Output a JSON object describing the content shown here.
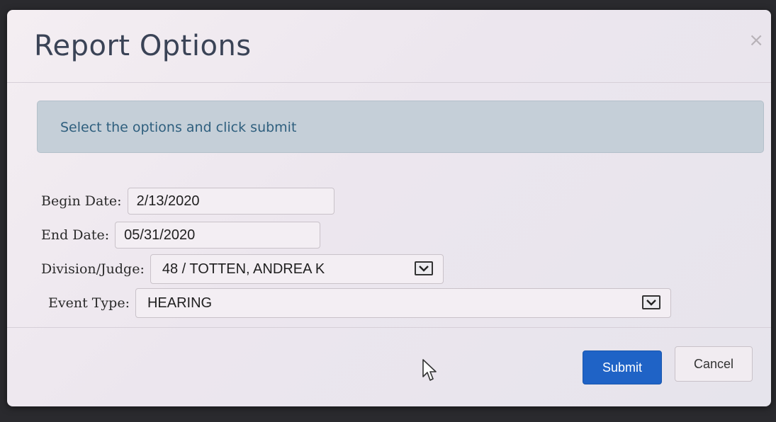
{
  "dialog": {
    "title": "Report Options",
    "close_label": "×"
  },
  "banner": {
    "text": "Select the options and click submit"
  },
  "form": {
    "begin_date": {
      "label": "Begin Date:",
      "value": "2/13/2020"
    },
    "end_date": {
      "label": "End Date:",
      "value": "05/31/2020"
    },
    "division_judge": {
      "label": "Division/Judge:",
      "value": "48 / TOTTEN, ANDREA K"
    },
    "event_type": {
      "label": "Event Type:",
      "value": "HEARING"
    }
  },
  "footer": {
    "submit_label": "Submit",
    "cancel_label": "Cancel"
  },
  "colors": {
    "accent": "#1f63c6",
    "banner": "#c5cfd8",
    "title": "#3a4356"
  }
}
